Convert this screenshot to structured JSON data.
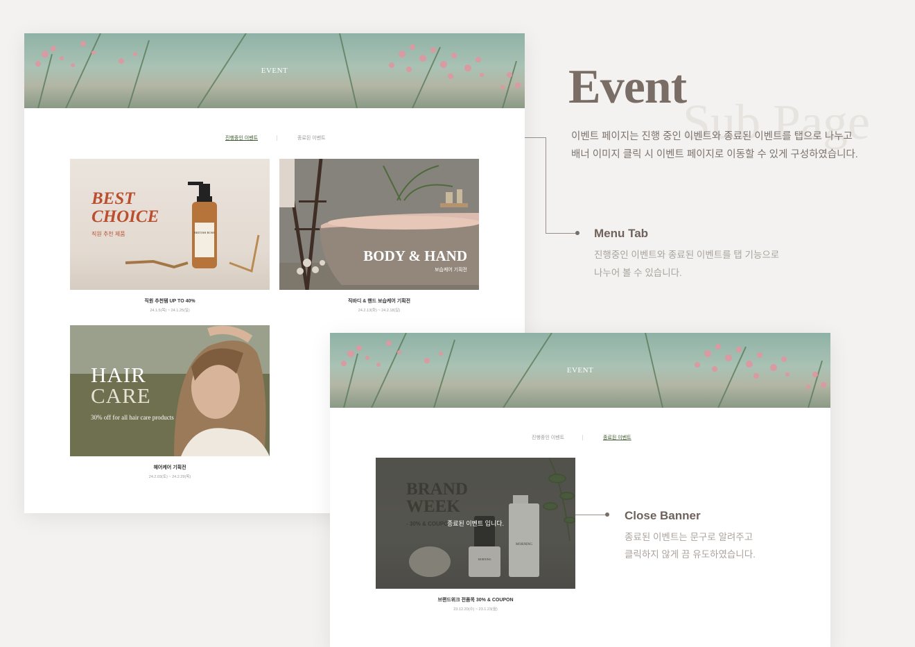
{
  "heading": {
    "title": "Event",
    "watermark": "Sub Page",
    "description": "이벤트 페이지는 진행 중인 이벤트와 종료된 이벤트를 탭으로 나누고 배너 이미지 클릭 시 이벤트 페이지로 이동할 수 있게 구성하였습니다."
  },
  "annotations": {
    "menu_tab": {
      "title": "Menu Tab",
      "desc_line1": "진행중인 이벤트와 종료된 이벤트를 탭 기능으로",
      "desc_line2": "나누어 볼 수 있습니다."
    },
    "close_banner": {
      "title": "Close Banner",
      "desc_line1": "종료된 이벤트는 문구로 알려주고",
      "desc_line2": "클릭하지 않게 끔 유도하였습니다."
    }
  },
  "panel_ongoing": {
    "hero_title": "EVENT",
    "tabs": [
      {
        "label": "진행중인 이벤트",
        "active": true
      },
      {
        "label": "종료된 이벤트",
        "active": false
      }
    ],
    "cards": [
      {
        "banner_line1": "BEST",
        "banner_line2": "CHOICE",
        "banner_sub": "직원 추천 제품",
        "bottle_label": "BRITISH ROSE",
        "title": "직원 추천템 UP TO 40%",
        "date": "24.1.5(목) ~ 24.1.25(일)"
      },
      {
        "banner_title": "BODY & HAND",
        "banner_sub": "보습케어 기획전",
        "title": "직바디 & 핸드 보습케어 기획전",
        "date": "24.2.13(화) ~ 24.2.18(일)"
      },
      {
        "banner_line1": "HAIR",
        "banner_line2": "CARE",
        "banner_sub": "30% off for all hair care products",
        "title": "헤어케어 기획전",
        "date": "24.2.03(토) ~ 24.2.29(목)"
      }
    ]
  },
  "panel_closed": {
    "hero_title": "EVENT",
    "tabs": [
      {
        "label": "진행중인 이벤트",
        "active": false
      },
      {
        "label": "종료된 이벤트",
        "active": true
      }
    ],
    "card": {
      "banner_line1": "BRAND",
      "banner_line2": "WEEK",
      "banner_sub": "- 30% & COUPON",
      "closed_label": "종료된 이벤트 입니다.",
      "bottle_label_1": "MORNING",
      "bottle_label_2": "MORNING",
      "title": "브랜드위크 전품목 30% & COUPON",
      "date": "23.12.20(수) ~ 23.1.23(월)"
    }
  },
  "colors": {
    "background": "#f3f2f0",
    "accent_brown": "#7a6d66",
    "active_tab": "#3a5a2a",
    "best_choice": "#b94f2e"
  }
}
